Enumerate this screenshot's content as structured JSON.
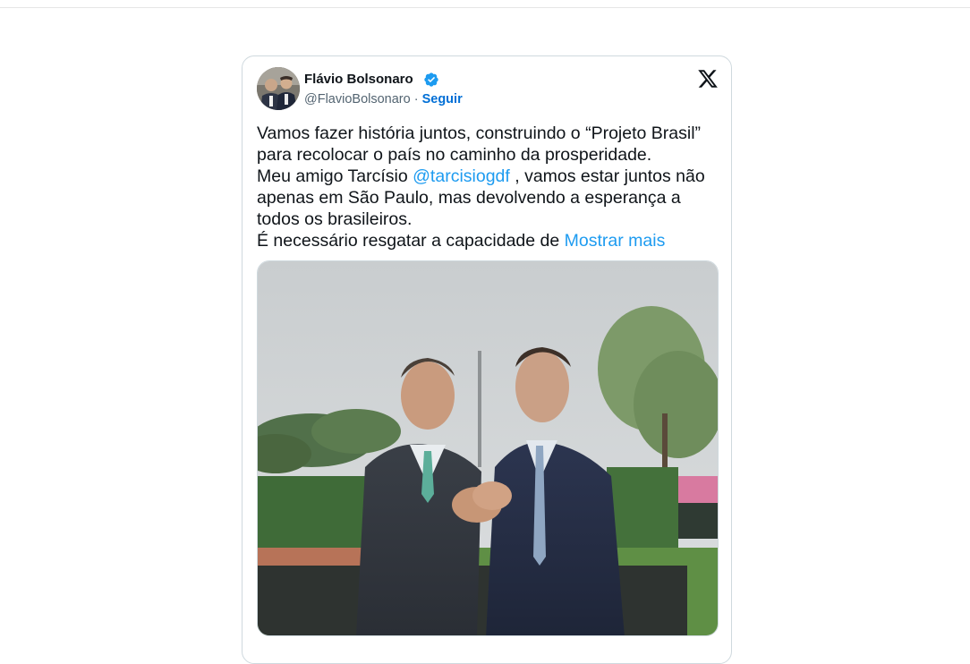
{
  "tweet": {
    "author": {
      "name": "Flávio Bolsonaro",
      "handle": "@FlavioBolsonaro",
      "separator": " · ",
      "follow_label": "Seguir",
      "verified_icon": "verified-badge-icon"
    },
    "platform_icon": "x-logo-icon",
    "text": {
      "line1": "Vamos fazer história juntos, construindo o “Projeto Brasil” para recolocar o país no caminho da prosperidade.",
      "line2_before": "Meu amigo Tarcísio ",
      "mention": "@tarcisiogdf",
      "line2_after": " , vamos estar juntos não apenas em São Paulo, mas devolvendo a esperança a todos os brasileiros.",
      "line3": "É necessário resgatar a capacidade de ",
      "show_more": "Mostrar mais"
    },
    "media": {
      "type": "photo",
      "description_icon": "photo-two-men-handshake"
    }
  },
  "colors": {
    "link": "#1d9bf0",
    "follow": "#006fd6",
    "verified": "#1d9bf0",
    "text": "#0f1419",
    "secondary": "#536471",
    "border": "#cfd9de"
  }
}
